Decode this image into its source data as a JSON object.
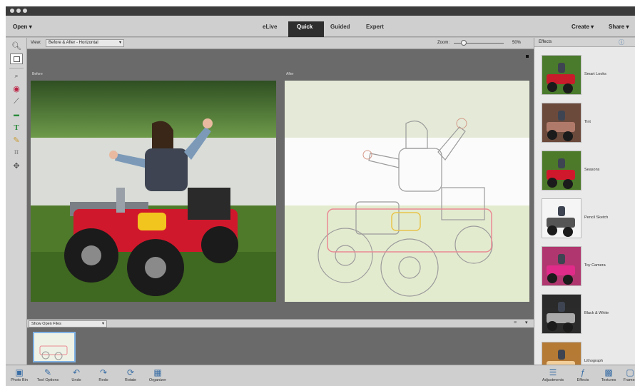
{
  "menubar": {
    "open_label": "Open",
    "modes": [
      "eLive",
      "Quick",
      "Guided",
      "Expert"
    ],
    "active_mode": "Quick",
    "create_label": "Create",
    "share_label": "Share"
  },
  "viewbar": {
    "view_label": "View:",
    "view_value": "Before & After - Horizontal",
    "zoom_label": "Zoom:",
    "zoom_value": "50%",
    "zoom_level": 0.2
  },
  "canvas": {
    "before_label": "Before",
    "after_label": "After"
  },
  "photo_bin": {
    "select_value": "Show Open Files"
  },
  "effects_panel": {
    "title": "Effects",
    "items": [
      {
        "label": "Smart Looks"
      },
      {
        "label": "Tint"
      },
      {
        "label": "Seasons"
      },
      {
        "label": "Pencil Sketch"
      },
      {
        "label": "Toy Camera"
      },
      {
        "label": "Black & White"
      },
      {
        "label": "Lithograph"
      }
    ]
  },
  "taskbar": {
    "left": [
      {
        "label": "Photo Bin",
        "icon": "photo-bin-icon"
      },
      {
        "label": "Tool Options",
        "icon": "tool-options-icon"
      },
      {
        "label": "Undo",
        "icon": "undo-icon"
      },
      {
        "label": "Redo",
        "icon": "redo-icon"
      },
      {
        "label": "Rotate",
        "icon": "rotate-icon"
      },
      {
        "label": "Organizer",
        "icon": "organizer-icon"
      }
    ],
    "right": [
      {
        "label": "Adjustments",
        "icon": "adjustments-icon"
      },
      {
        "label": "Effects",
        "icon": "effects-icon"
      },
      {
        "label": "Textures",
        "icon": "textures-icon"
      },
      {
        "label": "Frames",
        "icon": "frames-icon"
      }
    ]
  },
  "colors": {
    "accent": "#3a6ea5",
    "canvas_bg": "#6a6a6a",
    "jeep_red": "#d0182c"
  }
}
